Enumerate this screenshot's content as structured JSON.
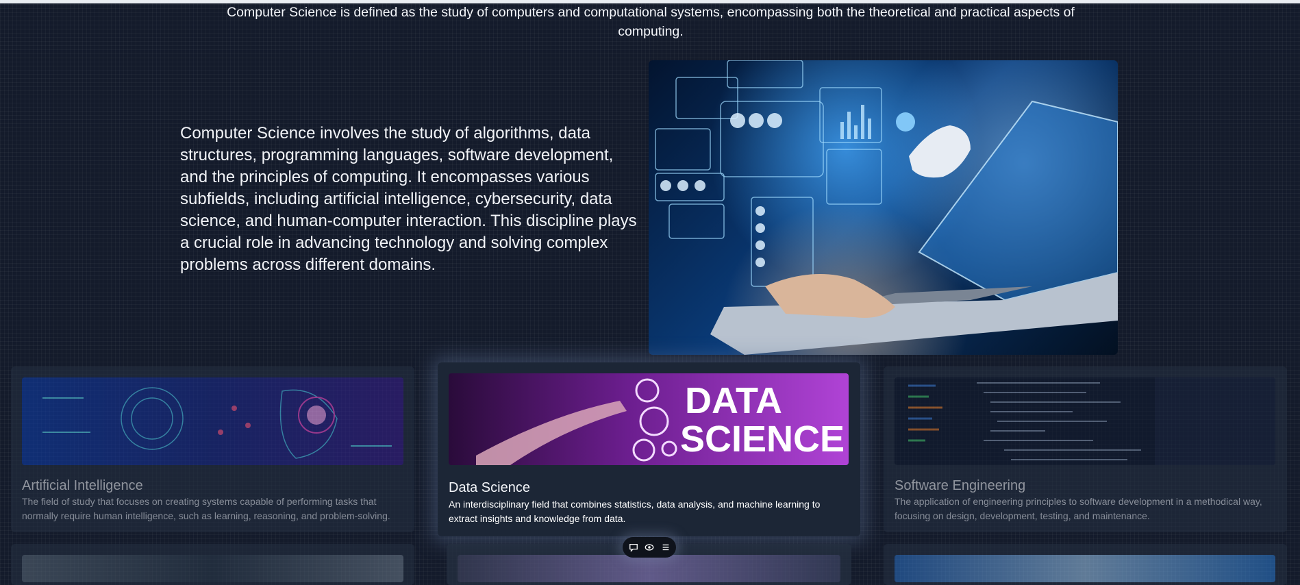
{
  "intro": "Computer Science is defined as the study of computers and computational systems, encompassing both the theoretical and practical aspects of computing.",
  "lead": "Computer Science involves the study of algorithms, data structures, programming languages, software development, and the principles of computing. It encompasses various subfields, including artificial intelligence, cybersecurity, data science, and human-computer interaction. This discipline plays a crucial role in advancing technology and solving complex problems across different domains.",
  "cards": [
    {
      "title": "Artificial Intelligence",
      "description": "The field of study that focuses on creating systems capable of performing tasks that normally require human intelligence, such as learning, reasoning, and problem-solving."
    },
    {
      "title": "Data Science",
      "description": "An interdisciplinary field that combines statistics, data analysis, and machine learning to extract insights and knowledge from data.",
      "image_text_line1": "DATA",
      "image_text_line2": "SCIENCE"
    },
    {
      "title": "Software Engineering",
      "description": "The application of engineering principles to software development in a methodical way, focusing on design, development, testing, and maintenance."
    }
  ],
  "toolbar": {
    "icons": [
      "comment-icon",
      "view-icon",
      "list-icon"
    ]
  },
  "colors": {
    "background": "#141b2b",
    "card": "#253041",
    "card_active": "#1c2636",
    "data_science_purple": "#9b2fbf"
  }
}
